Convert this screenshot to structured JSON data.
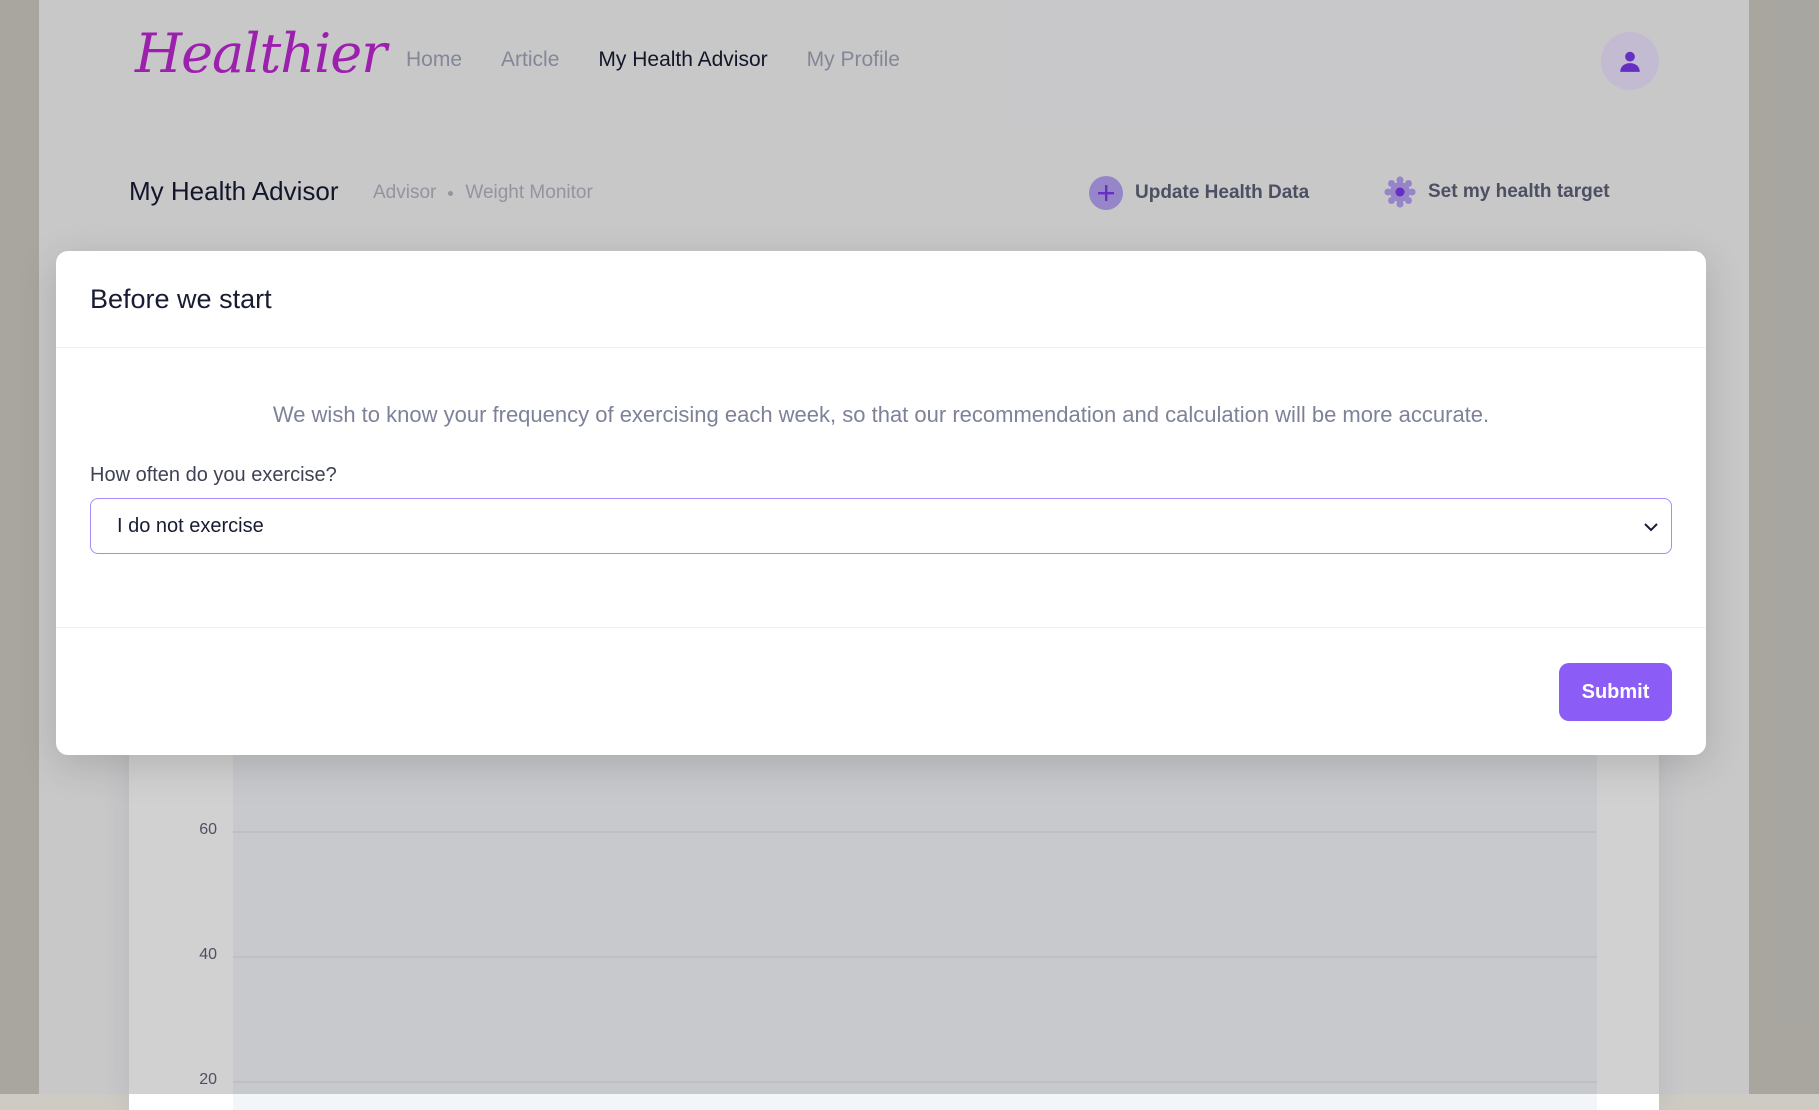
{
  "app": {
    "logo_text": "Healthier"
  },
  "nav": {
    "items": [
      {
        "label": "Home",
        "active": false
      },
      {
        "label": "Article",
        "active": false
      },
      {
        "label": "My Health Advisor",
        "active": true
      },
      {
        "label": "My Profile",
        "active": false
      }
    ]
  },
  "header": {
    "avatar_icon": "user-icon"
  },
  "subheader": {
    "title": "My Health Advisor",
    "breadcrumb": [
      "Advisor",
      "Weight Monitor"
    ],
    "update_label": "Update Health Data",
    "target_label": "Set my health target"
  },
  "modal": {
    "title": "Before we start",
    "description": "We wish to know your frequency of exercising each week, so that our recommendation and calculation will be more accurate.",
    "field_label": "How often do you exercise?",
    "select_value": "I do not exercise",
    "submit_label": "Submit"
  },
  "chart_data": {
    "type": "line",
    "y_ticks": [
      60,
      40,
      20
    ],
    "series": []
  },
  "colors": {
    "accent": "#8b5cf6",
    "logo": "#c026d3",
    "select_border": "#a78bfa"
  }
}
